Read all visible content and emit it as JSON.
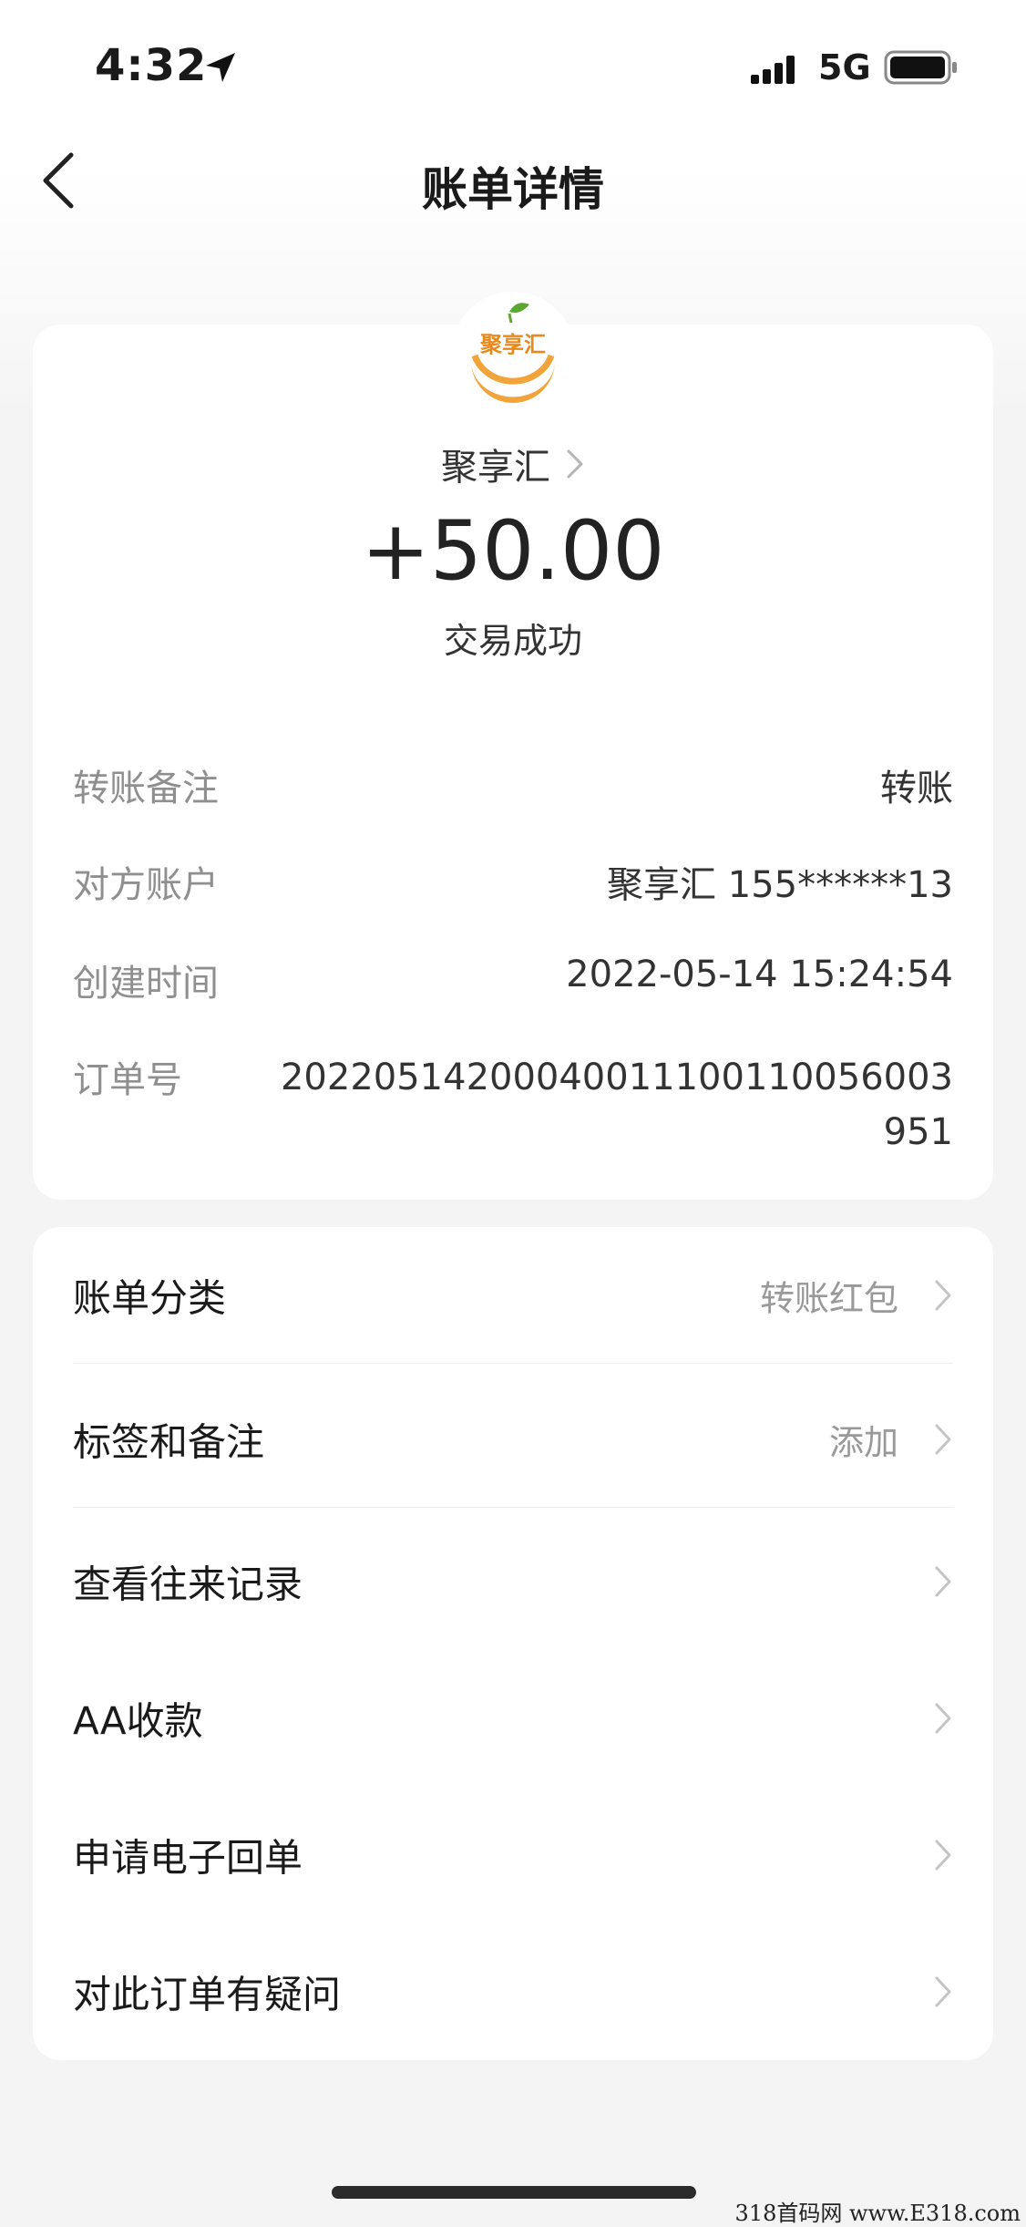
{
  "status_bar": {
    "time": "4:32",
    "network": "5G"
  },
  "header": {
    "title": "账单详情"
  },
  "merchant": {
    "name": "聚享汇",
    "logo_text": "聚享汇"
  },
  "transaction": {
    "amount": "+50.00",
    "status": "交易成功"
  },
  "details": [
    {
      "label": "转账备注",
      "value": "转账"
    },
    {
      "label": "对方账户",
      "value": "聚享汇 155******13"
    },
    {
      "label": "创建时间",
      "value": "2022-05-14 15:24:54"
    },
    {
      "label": "订单号",
      "value": "20220514200040011100110056003951"
    }
  ],
  "menu": [
    {
      "label": "账单分类",
      "value": "转账红包"
    },
    {
      "label": "标签和备注",
      "value": "添加"
    },
    {
      "label": "查看往来记录",
      "value": ""
    },
    {
      "label": "AA收款",
      "value": ""
    },
    {
      "label": "申请电子回单",
      "value": ""
    },
    {
      "label": "对此订单有疑问",
      "value": ""
    }
  ],
  "watermark": "318首码网 www.E318.com",
  "colors": {
    "logo_orange": "#f2a33a",
    "logo_green": "#5aa832",
    "label_gray": "#8f8f8f"
  }
}
